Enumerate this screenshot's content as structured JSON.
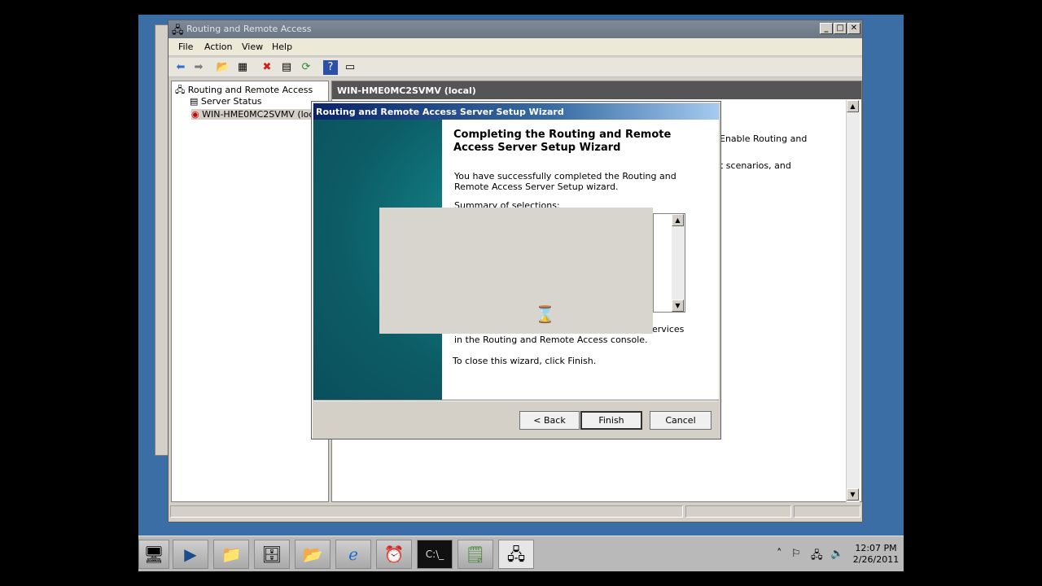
{
  "main_window": {
    "title": "Routing and Remote Access",
    "controls": {
      "minimize": "_",
      "maximize": "□",
      "close": "✕"
    },
    "menu": [
      "File",
      "Action",
      "View",
      "Help"
    ],
    "tree": {
      "root": "Routing and Remote Access",
      "items": [
        "Server Status",
        "WIN-HME0MC2SVMV (local)"
      ]
    },
    "right_panel": {
      "header": "WIN-HME0MC2SVMV (local)",
      "partial_text_1": "Enable Routing and",
      "partial_text_2": "t scenarios, and"
    }
  },
  "wizard": {
    "title": "Routing and Remote Access Server Setup Wizard",
    "heading": "Completing the Routing and Remote Access Server Setup Wizard",
    "success_text": "You have successfully completed the Routing and Remote Access Server Setup wizard.",
    "summary_label": "Summary of selections:",
    "partial_services": "ervices",
    "console_text": "in the Routing and  Remote Access console.",
    "close_text": "To close this wizard, click Finish.",
    "buttons": {
      "back": "< Back",
      "finish": "Finish",
      "cancel": "Cancel"
    },
    "busy_cursor": "⌛"
  },
  "taskbar": {
    "time": "12:07 PM",
    "date": "2/26/2011",
    "apps": [
      "server-manager",
      "powershell",
      "explorer",
      "services",
      "folder",
      "internet-explorer",
      "task-scheduler",
      "command-prompt",
      "notepad",
      "routing-remote-access"
    ]
  }
}
